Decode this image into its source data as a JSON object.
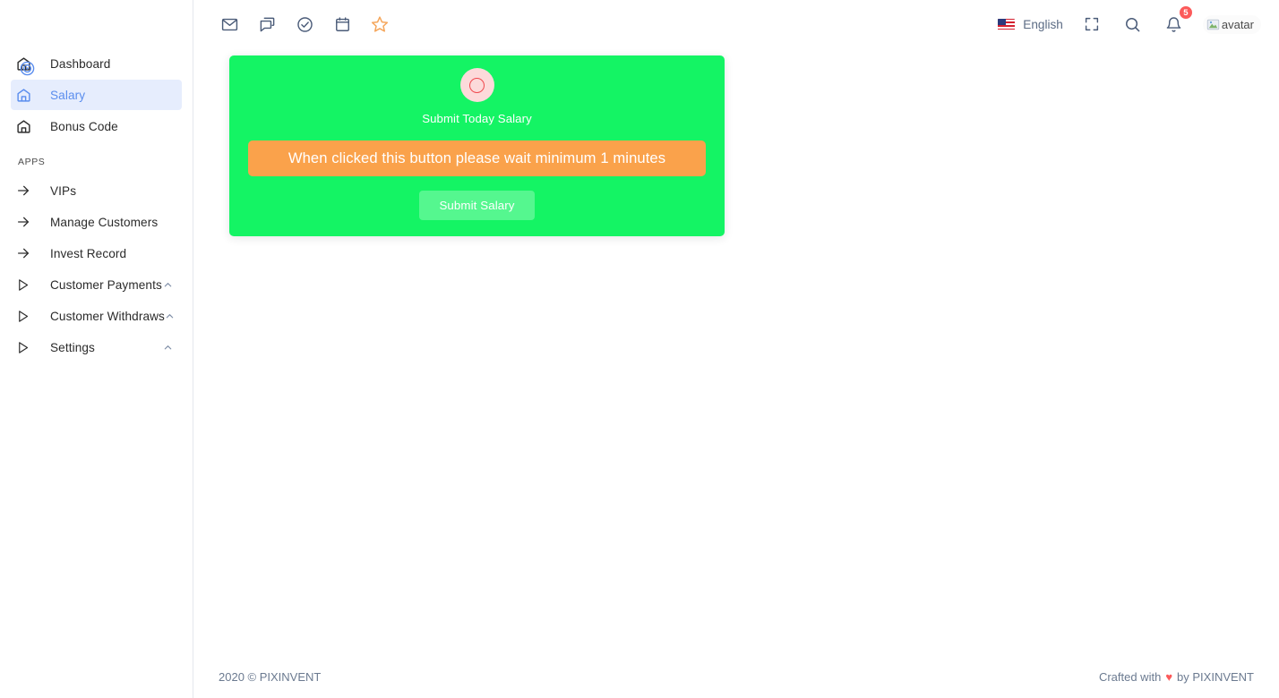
{
  "header": {
    "left_icons": [
      {
        "name": "mail-icon",
        "label": "Email"
      },
      {
        "name": "chat-icon",
        "label": "Chat"
      },
      {
        "name": "check-circle-icon",
        "label": "Todo"
      },
      {
        "name": "calendar-icon",
        "label": "Calendar"
      },
      {
        "name": "star-icon",
        "label": "Favorites"
      }
    ],
    "language": "English",
    "language_flag": "us-flag-icon",
    "fullscreen_icon": "fullscreen-icon",
    "search_icon": "search-icon",
    "notifications_icon": "bell-icon",
    "notifications_count": "5",
    "avatar_alt": "avatar"
  },
  "sidebar": {
    "main_items": [
      {
        "label": "Dashboard",
        "icon": "home-icon",
        "active": false
      },
      {
        "label": "Salary",
        "icon": "home-icon",
        "active": true
      },
      {
        "label": "Bonus Code",
        "icon": "home-icon",
        "active": false
      }
    ],
    "section_label": "APPS",
    "app_items": [
      {
        "label": "VIPs",
        "icon": "arrow-right-icon",
        "collapsible": false
      },
      {
        "label": "Manage Customers",
        "icon": "arrow-right-icon",
        "collapsible": false
      },
      {
        "label": "Invest Record",
        "icon": "arrow-right-icon",
        "collapsible": false
      },
      {
        "label": "Customer Payments",
        "icon": "play-triangle-icon",
        "collapsible": true
      },
      {
        "label": "Customer Withdraws",
        "icon": "play-triangle-icon",
        "collapsible": true
      },
      {
        "label": "Settings",
        "icon": "play-triangle-icon",
        "collapsible": true
      }
    ]
  },
  "main": {
    "salary_card": {
      "status_icon": "circle-ring-icon",
      "title": "Submit Today Salary",
      "warning": "When clicked this button please wait minimum 1 minutes",
      "submit_label": "Submit Salary",
      "bg_color": "#14f464",
      "warning_color": "#faa24b"
    }
  },
  "footer": {
    "copyright": "2020 © PIXINVENT",
    "crafted_prefix": "Crafted with",
    "heart": "♥",
    "crafted_suffix": "by PIXINVENT"
  }
}
